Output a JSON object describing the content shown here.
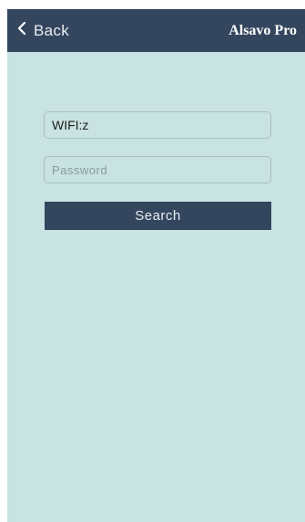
{
  "navbar": {
    "back_label": "Back",
    "back_icon": "chevron-left-icon",
    "title": "Alsavo Pro"
  },
  "form": {
    "wifi_value": "WIFI:z",
    "password_value": "",
    "password_placeholder": "Password",
    "search_label": "Search"
  },
  "colors": {
    "navbar_bg": "#34465e",
    "page_bg": "#c8e3e1",
    "button_bg": "#34465e"
  }
}
